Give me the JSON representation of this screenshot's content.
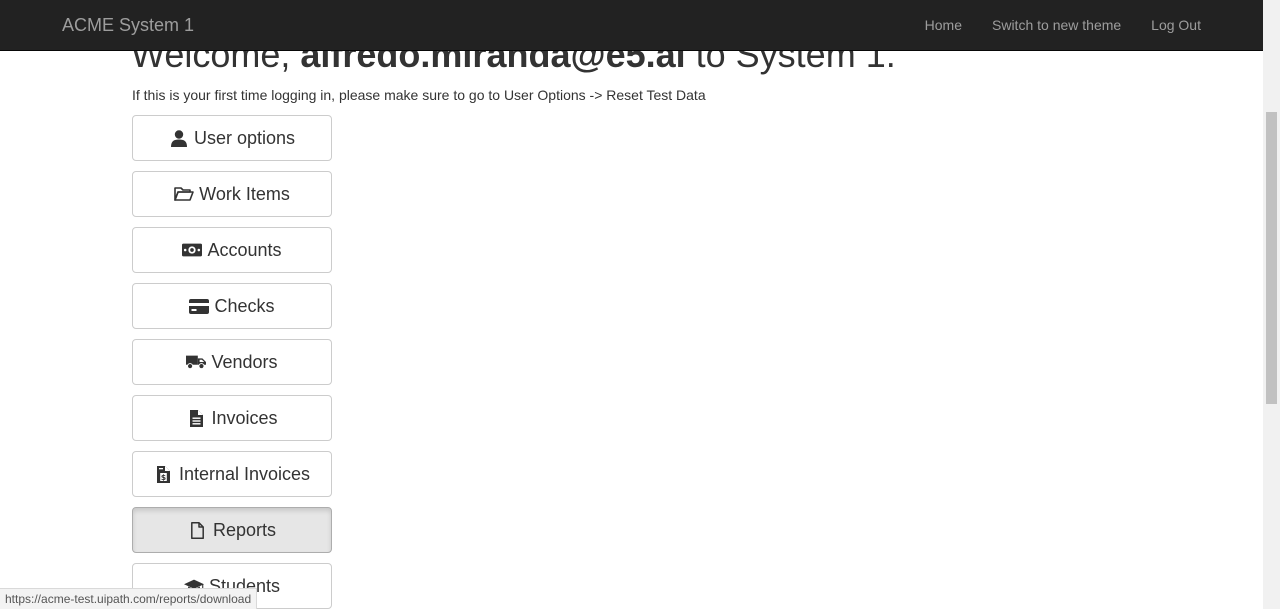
{
  "navbar": {
    "brand": "ACME System 1",
    "links": [
      "Home",
      "Switch to new theme",
      "Log Out"
    ]
  },
  "main": {
    "welcome_prefix": "Welcome, ",
    "welcome_user": "alfredo.miranda@e5.ai",
    "welcome_suffix": " to System 1.",
    "hint": "If this is your first time logging in, please make sure to go to User Options -> Reset Test Data"
  },
  "menu": [
    {
      "label": "User options",
      "icon": "user-icon"
    },
    {
      "label": "Work Items",
      "icon": "folder-open-icon"
    },
    {
      "label": "Accounts",
      "icon": "money-icon"
    },
    {
      "label": "Checks",
      "icon": "credit-card-icon"
    },
    {
      "label": "Vendors",
      "icon": "truck-icon"
    },
    {
      "label": "Invoices",
      "icon": "file-text-icon"
    },
    {
      "label": "Internal Invoices",
      "icon": "file-invoice-dollar-icon"
    },
    {
      "label": "Reports",
      "icon": "file-icon",
      "active": true
    },
    {
      "label": "Students",
      "icon": "graduation-cap-icon"
    }
  ],
  "status_bar": {
    "url": "https://acme-test.uipath.com/reports/download"
  }
}
